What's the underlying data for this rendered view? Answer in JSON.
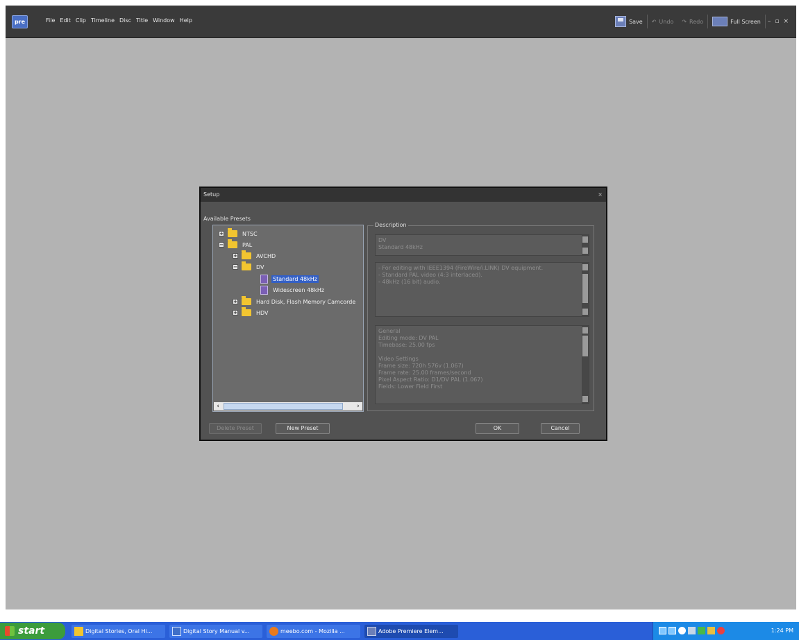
{
  "app": {
    "logo": "pre",
    "menu": [
      "File",
      "Edit",
      "Clip",
      "Timeline",
      "Disc",
      "Title",
      "Window",
      "Help"
    ],
    "toolbar": {
      "save": "Save",
      "undo": "Undo",
      "redo": "Redo",
      "full_screen": "Full Screen"
    },
    "window_controls": {
      "minimize": "–",
      "restore": "▫",
      "close": "×"
    }
  },
  "dialog": {
    "title": "Setup",
    "close": "×",
    "presets_label": "Available Presets",
    "tree": [
      {
        "label": "NTSC",
        "expander": "+",
        "icon": "folder-icon"
      },
      {
        "label": "PAL",
        "expander": "−",
        "icon": "folder-icon"
      },
      {
        "label": "AVCHD",
        "expander": "+",
        "icon": "folder-icon"
      },
      {
        "label": "DV",
        "expander": "−",
        "icon": "folder-icon"
      },
      {
        "label": "Standard 48kHz",
        "icon": "preset-icon",
        "selected": true
      },
      {
        "label": "Widescreen 48kHz",
        "icon": "preset-icon"
      },
      {
        "label": "Hard Disk, Flash Memory Camcorde",
        "expander": "+",
        "icon": "folder-icon"
      },
      {
        "label": "HDV",
        "expander": "+",
        "icon": "folder-icon"
      }
    ],
    "description_legend": "Description",
    "description_title": [
      "DV",
      "Standard 48kHz"
    ],
    "description_notes": [
      "- For editing with IEEE1394 (FireWire/i.LINK) DV equipment.",
      "- Standard PAL video (4:3 interlaced).",
      "- 48kHz (16 bit) audio."
    ],
    "details": [
      "General",
      "  Editing mode: DV PAL",
      "  Timebase: 25.00 fps",
      "",
      "Video Settings",
      "  Frame size: 720h 576v (1.067)",
      "  Frame rate: 25.00 frames/second",
      "  Pixel Aspect Ratio: D1/DV PAL (1.067)",
      "  Fields: Lower Field First"
    ],
    "buttons": {
      "delete_preset": "Delete Preset",
      "new_preset": "New Preset",
      "ok": "OK",
      "cancel": "Cancel"
    }
  },
  "taskbar": {
    "start": "start",
    "tasks": [
      "Digital Stories, Oral Hi...",
      "Digital Story Manual v...",
      "meebo.com - Mozilla ...",
      "Adobe Premiere Elem..."
    ],
    "language": "EN",
    "clock": "1:24 PM"
  },
  "colors": {
    "workspace": "#b3b3b3",
    "dialog": "#525252",
    "selection": "#3460c6",
    "taskbar": "#2a5fd8",
    "start": "#3c9c3c"
  }
}
